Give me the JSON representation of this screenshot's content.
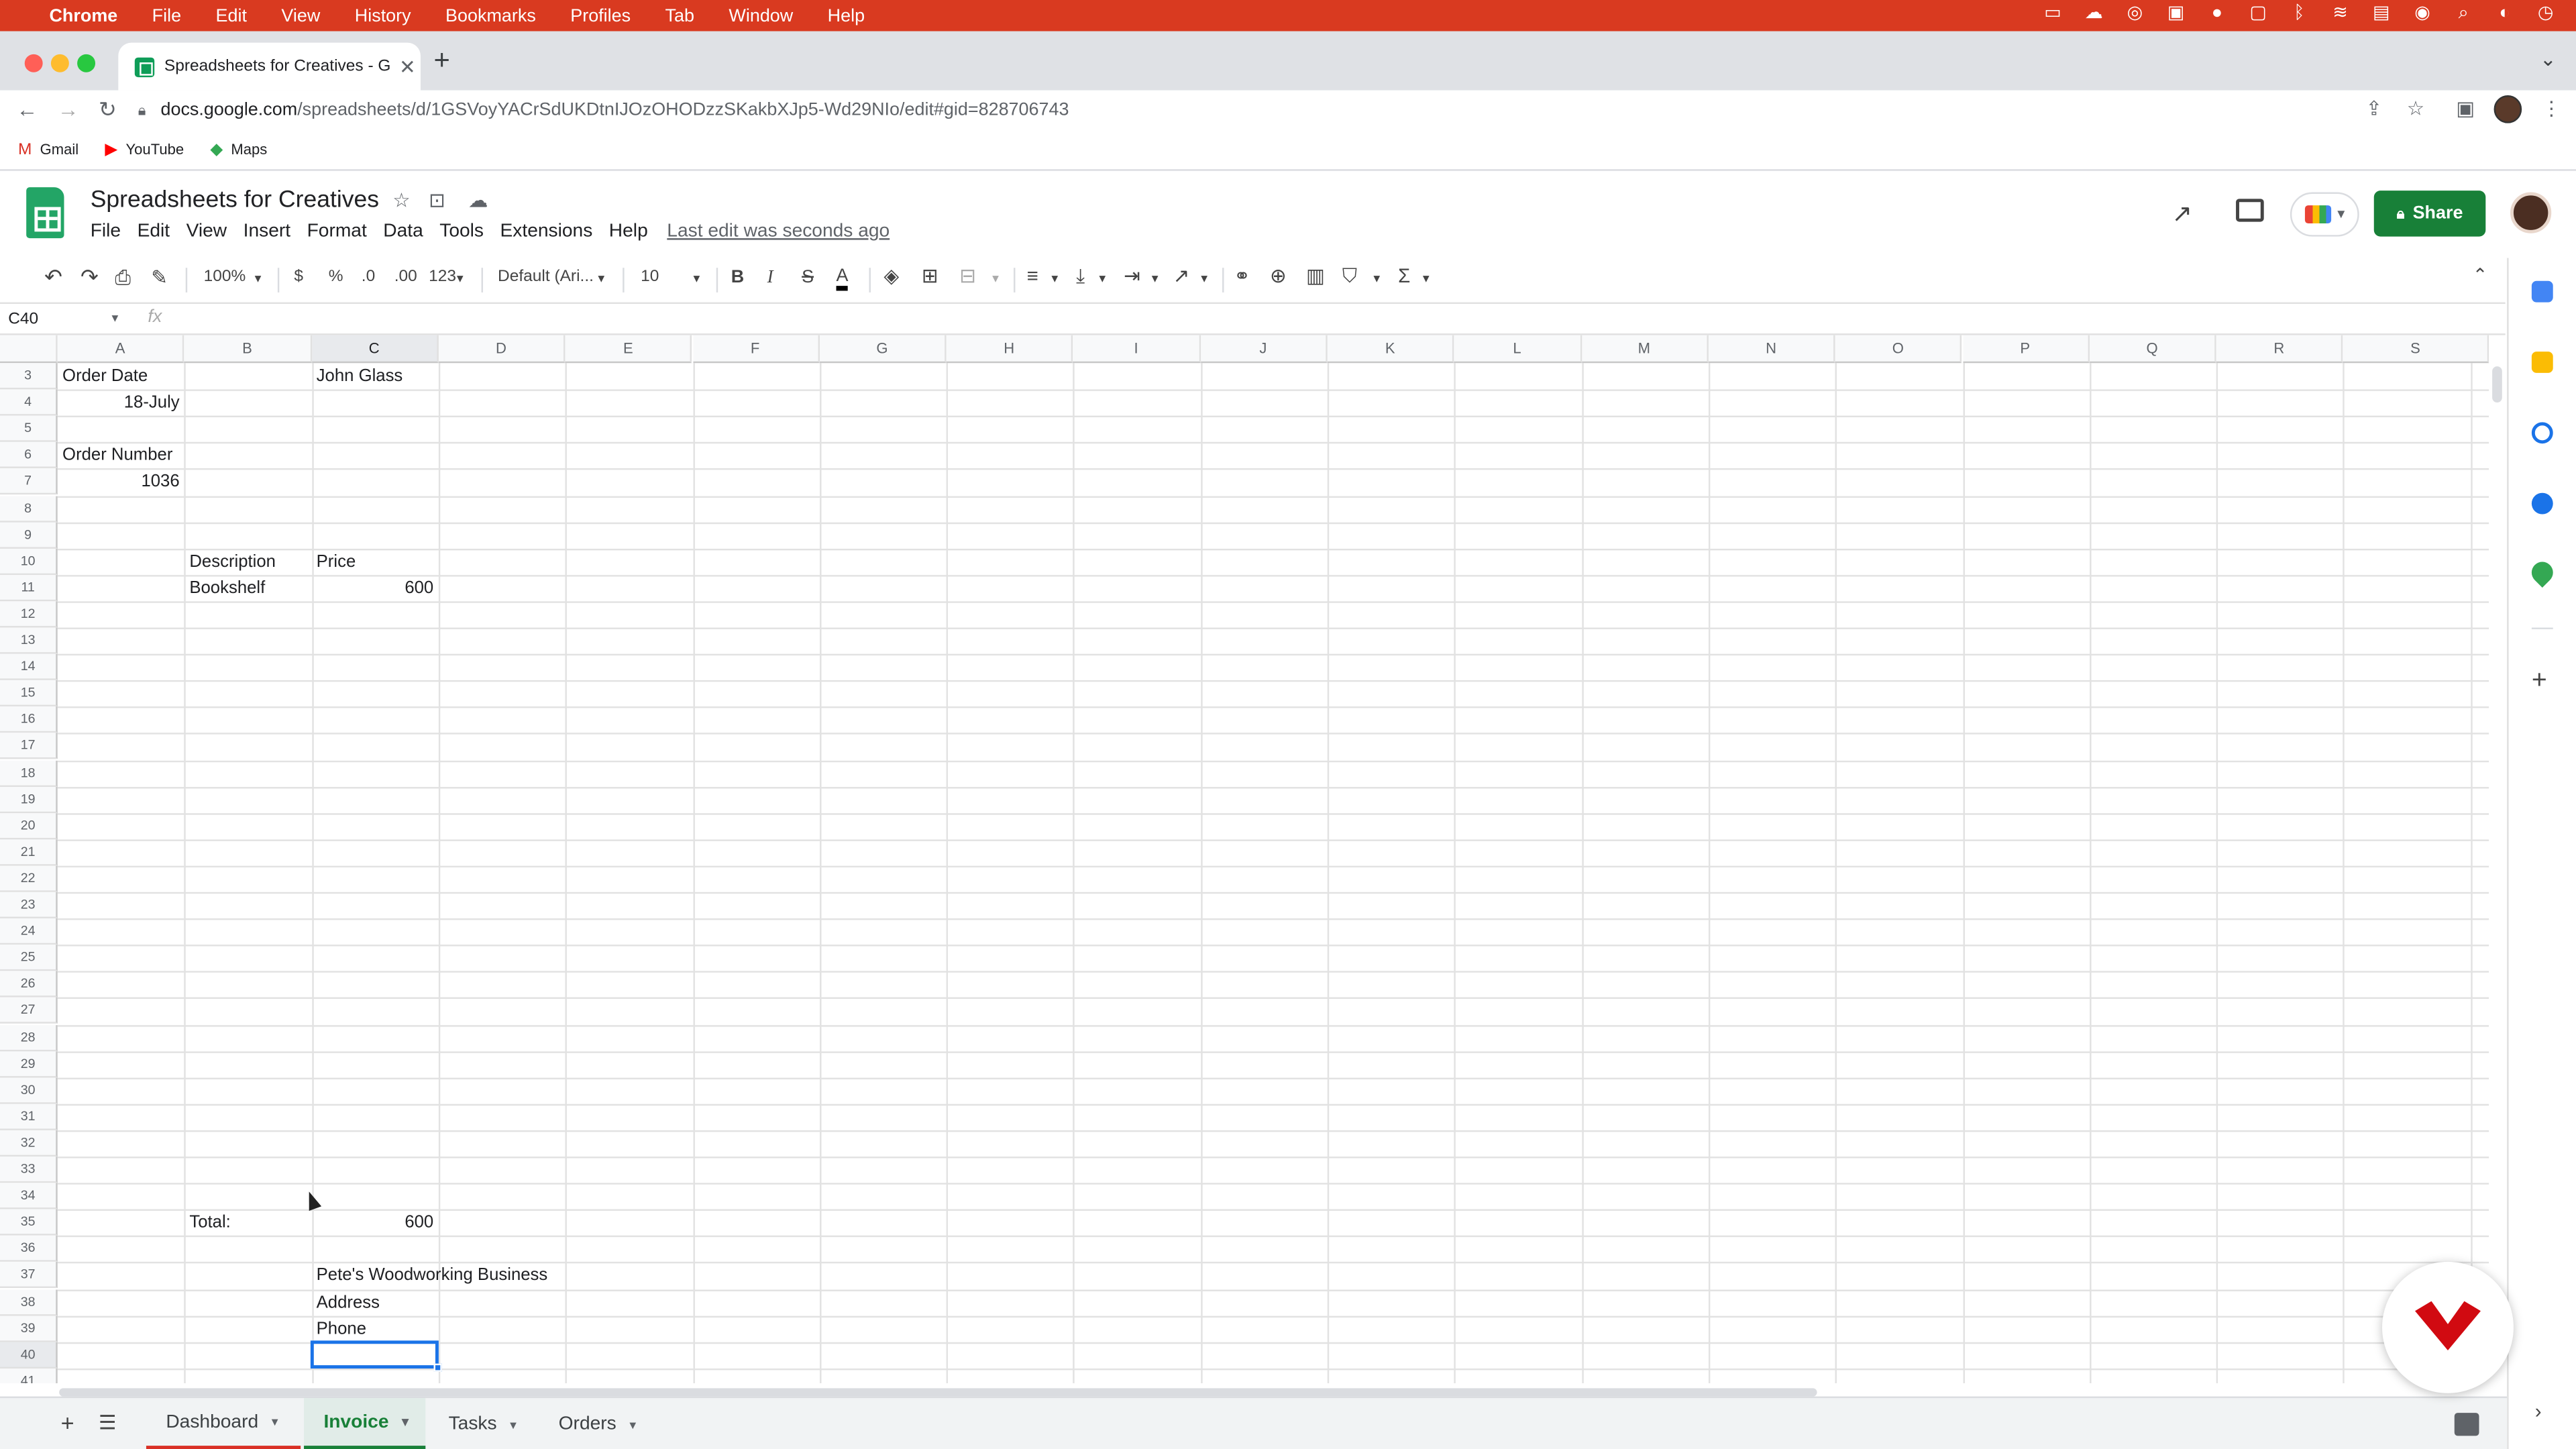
{
  "mac_menu": {
    "app": "Chrome",
    "items": [
      "File",
      "Edit",
      "View",
      "History",
      "Bookmarks",
      "Profiles",
      "Tab",
      "Window",
      "Help"
    ]
  },
  "browser": {
    "tab_title": "Spreadsheets for Creatives - G",
    "url_host": "docs.google.com",
    "url_path": "/spreadsheets/d/1GSVoyYACrSdUKDtnIJOzOHODzzSKakbXJp5-Wd29NIo/edit#gid=828706743",
    "bookmarks": [
      "Gmail",
      "YouTube",
      "Maps"
    ]
  },
  "sheets": {
    "doc_title": "Spreadsheets for Creatives",
    "menus": [
      "File",
      "Edit",
      "View",
      "Insert",
      "Format",
      "Data",
      "Tools",
      "Extensions",
      "Help"
    ],
    "last_edit": "Last edit was seconds ago",
    "share_label": "Share"
  },
  "toolbar": {
    "zoom": "100%",
    "currency": "$",
    "percent": "%",
    "dec_decrease": ".0",
    "dec_increase": ".00",
    "more_formats": "123",
    "font": "Default (Ari...",
    "font_size": "10",
    "bold": "B",
    "italic": "I",
    "strike": "S",
    "text_color": "A"
  },
  "formula_bar": {
    "name_box": "C40",
    "fx": "fx"
  },
  "columns": [
    "A",
    "B",
    "C",
    "D",
    "E",
    "F",
    "G",
    "H",
    "I",
    "J",
    "K",
    "L",
    "M",
    "N",
    "O",
    "P",
    "Q",
    "R",
    "S"
  ],
  "rows": [
    "3",
    "4",
    "5",
    "6",
    "7",
    "8",
    "9",
    "10",
    "11",
    "12",
    "13",
    "14",
    "15",
    "16",
    "17",
    "18",
    "19",
    "20",
    "21",
    "22",
    "23",
    "24",
    "25",
    "26",
    "27",
    "28",
    "29",
    "30",
    "31",
    "32",
    "33",
    "34",
    "35",
    "36",
    "37",
    "38",
    "39",
    "40",
    "41"
  ],
  "cells": {
    "A3": "Order Date",
    "C3": "John Glass",
    "A4": "18-July",
    "A6": "Order Number",
    "A7": "1036",
    "B10": "Description",
    "C10": "Price",
    "B11": "Bookshelf",
    "C11": "600",
    "B35": "Total:",
    "C35": "600",
    "C37": "Pete's Woodworking Business",
    "C38": "Address",
    "C39": "Phone"
  },
  "sheet_tabs": [
    {
      "label": "Dashboard"
    },
    {
      "label": "Invoice"
    },
    {
      "label": "Tasks"
    },
    {
      "label": "Orders"
    }
  ],
  "colors": {
    "mac_bar": "#d93a20",
    "sheets_green": "#188038",
    "selection": "#1a73e8",
    "dashboard_tab_accent": "#d93025"
  }
}
